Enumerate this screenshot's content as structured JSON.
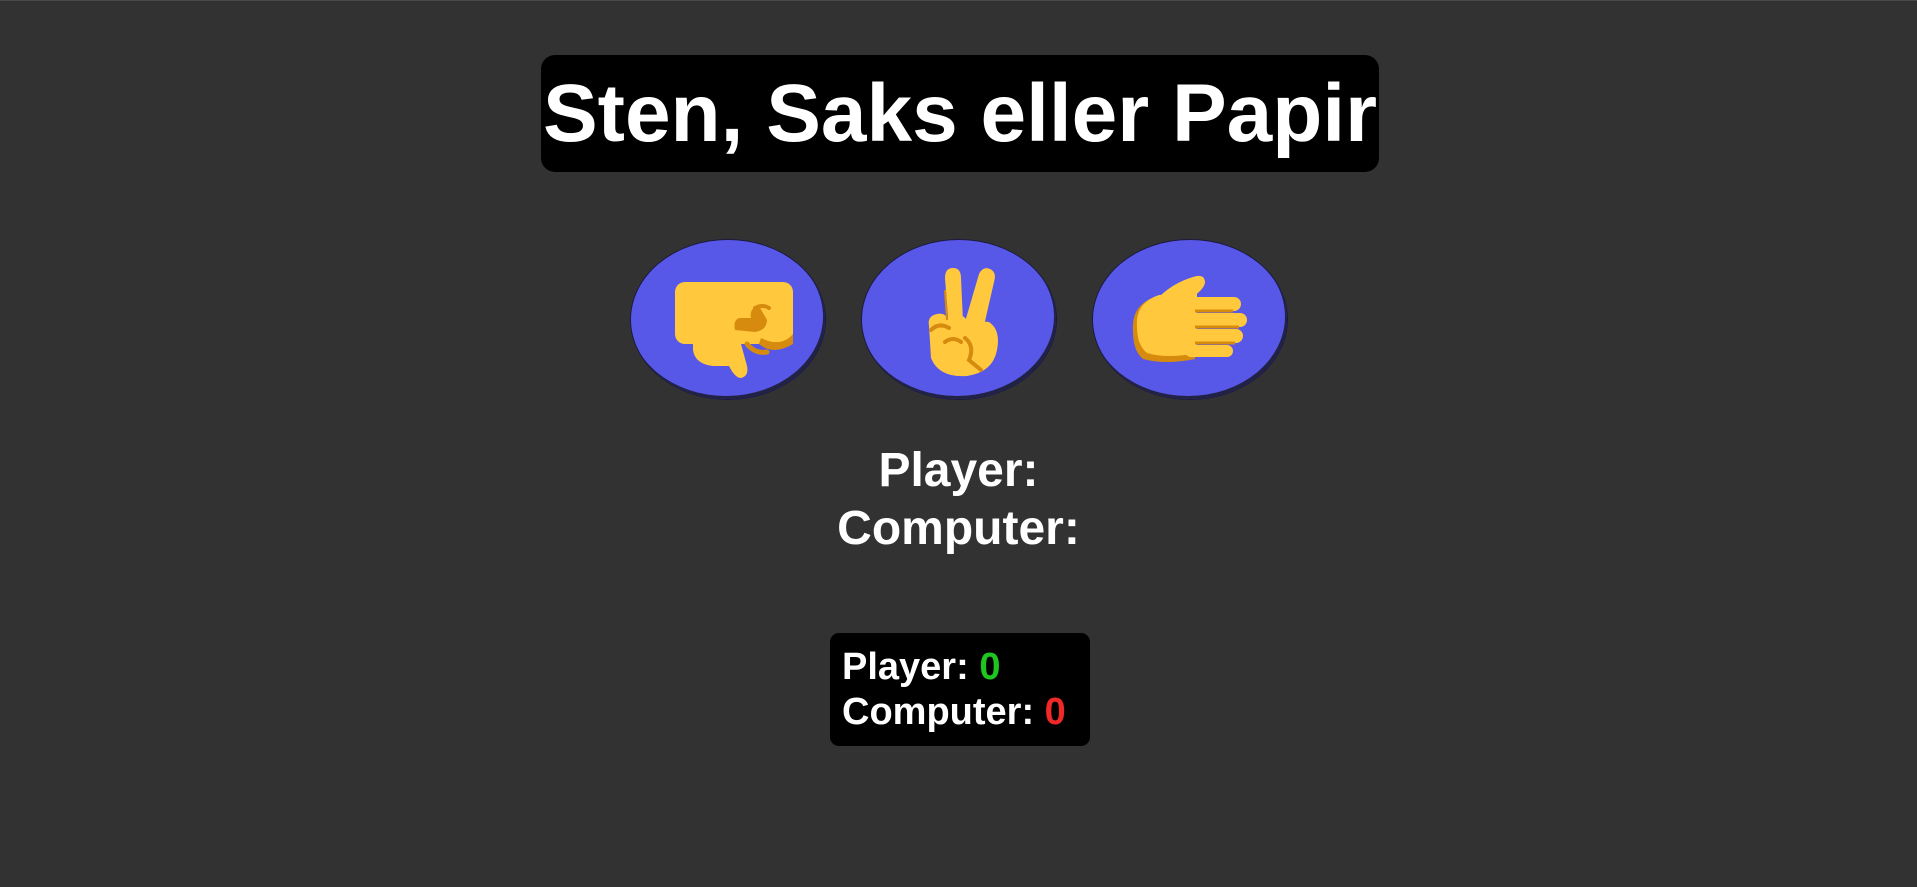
{
  "title": "Sten, Saks eller Papir",
  "choices": [
    {
      "id": "rock",
      "icon": "fist-rock-icon"
    },
    {
      "id": "scissors",
      "icon": "victory-hand-scissors-icon"
    },
    {
      "id": "paper",
      "icon": "open-hand-paper-icon"
    }
  ],
  "result": {
    "player_label": "Player:",
    "player_choice": "",
    "computer_label": "Computer:",
    "computer_choice": ""
  },
  "score": {
    "player_label": "Player:",
    "player_value": "0",
    "computer_label": "Computer:",
    "computer_value": "0"
  },
  "colors": {
    "background": "#333233",
    "button": "#5858e8",
    "hand": "#ffc83d",
    "hand_shade": "#d68b0f",
    "player_score": "#1fc61f",
    "computer_score": "#f02828"
  }
}
